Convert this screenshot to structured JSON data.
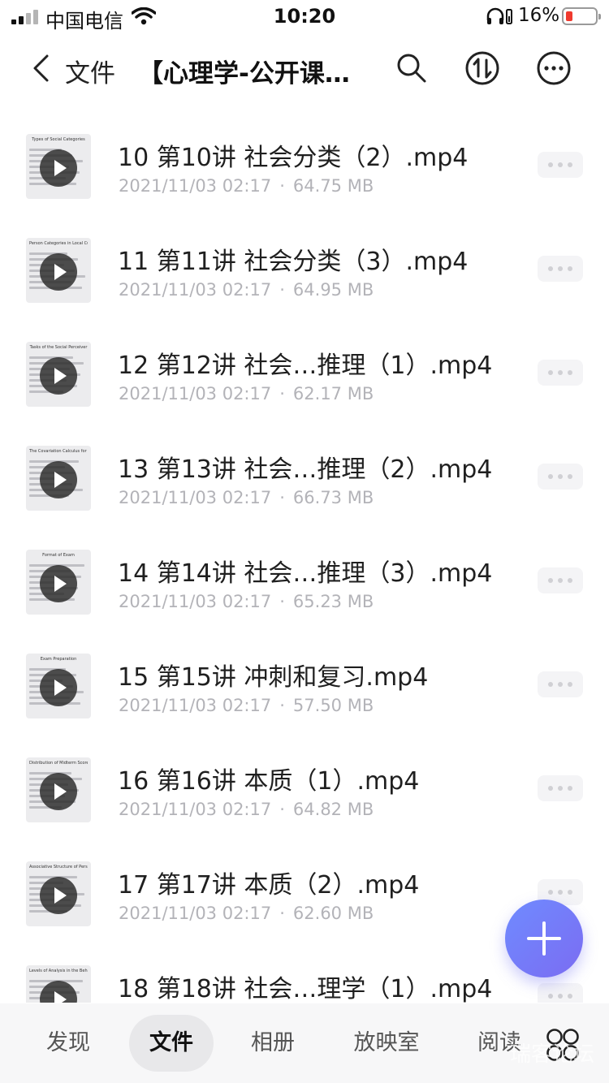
{
  "status_bar": {
    "carrier": "中国电信",
    "time": "10:20",
    "battery": "16%"
  },
  "nav": {
    "back_label": "文件",
    "title": "【心理学-公开课…",
    "icons": [
      "back-icon",
      "search-icon",
      "sort-icon",
      "more-icon"
    ]
  },
  "files": [
    {
      "name": "10 第10讲 社会分类（2）.mp4",
      "date": "2021/11/03 02:17",
      "size": "64.75 MB",
      "thumb_title": "Types of Social Categories"
    },
    {
      "name": "11 第11讲 社会分类（3）.mp4",
      "date": "2021/11/03 02:17",
      "size": "64.95 MB",
      "thumb_title": "Person Categories in Local Culture"
    },
    {
      "name": "12 第12讲 社会…推理（1）.mp4",
      "date": "2021/11/03 02:17",
      "size": "62.17 MB",
      "thumb_title": "Tasks of the Social Perceiver"
    },
    {
      "name": "13 第13讲 社会…推理（2）.mp4",
      "date": "2021/11/03 02:17",
      "size": "66.73 MB",
      "thumb_title": "The Covariation Calculus for Causal Attribution"
    },
    {
      "name": "14 第14讲 社会…推理（3）.mp4",
      "date": "2021/11/03 02:17",
      "size": "65.23 MB",
      "thumb_title": "Format of Exam"
    },
    {
      "name": "15 第15讲 冲刺和复习.mp4",
      "date": "2021/11/03 02:17",
      "size": "57.50 MB",
      "thumb_title": "Exam Preparation"
    },
    {
      "name": "16 第16讲 本质（1）.mp4",
      "date": "2021/11/03 02:17",
      "size": "64.82 MB",
      "thumb_title": "Distribution of Midterm Scores"
    },
    {
      "name": "17 第17讲 本质（2）.mp4",
      "date": "2021/11/03 02:17",
      "size": "62.60 MB",
      "thumb_title": "Associative Structure of Person Memory"
    },
    {
      "name": "18 第18讲 社会…理学（1）.mp4",
      "date": "",
      "size": "",
      "thumb_title": "Levels of Analysis in the Behavioral Sciences"
    }
  ],
  "meta_separator": "·",
  "tabs": [
    {
      "label": "发现",
      "active": false
    },
    {
      "label": "文件",
      "active": true
    },
    {
      "label": "相册",
      "active": false
    },
    {
      "label": "放映室",
      "active": false
    },
    {
      "label": "阅读",
      "active": false
    }
  ],
  "watermark": "瑞客论坛",
  "colors": {
    "fab_start": "#6f8bff",
    "fab_end": "#7b6cf2",
    "battery_low": "#f03a2e",
    "meta_text": "#b3b3b8"
  }
}
